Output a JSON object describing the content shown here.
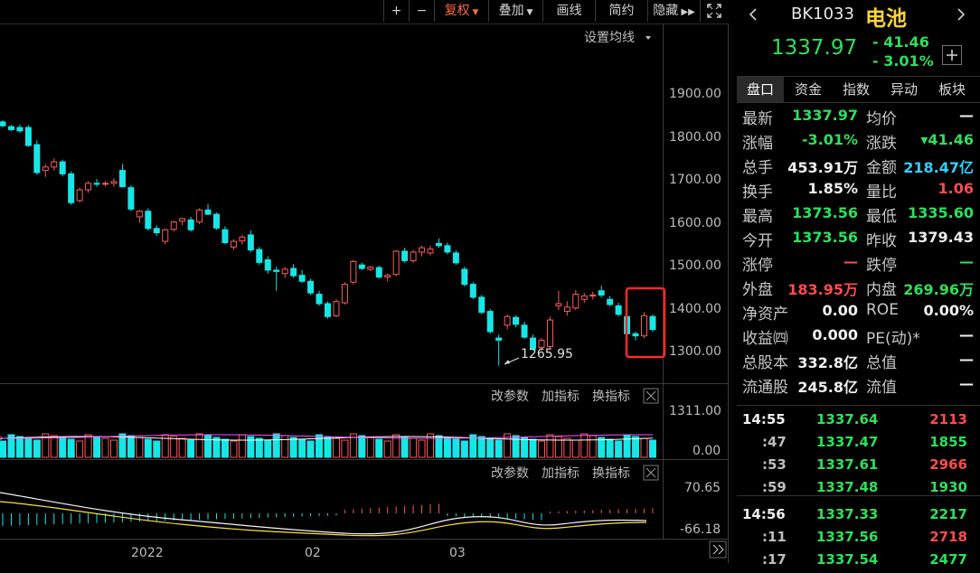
{
  "toolbar": {
    "plus": "+",
    "minus": "−",
    "fuquan": "复权",
    "diejia": "叠加",
    "huaxian": "画线",
    "jianyue": "简约",
    "yincang": "隐藏"
  },
  "chart": {
    "set_ma": "设置均线",
    "min_label": "1265.95",
    "y_ticks": [
      "1900.00",
      "1800.00",
      "1700.00",
      "1600.00",
      "1500.00",
      "1400.00",
      "1300.00"
    ],
    "vol_ticks": [
      "1311.00",
      "0.00"
    ],
    "macd_ticks": [
      "70.65",
      "-66.18"
    ],
    "indicator_buttons": [
      "改参数",
      "加指标",
      "换指标"
    ],
    "x_labels": [
      "2022",
      "02",
      "03"
    ]
  },
  "chart_data": {
    "type": "candlestick",
    "ylim": [
      1230,
      1960
    ],
    "x_labels": [
      "2022",
      "02",
      "03"
    ],
    "candles": [
      [
        1833,
        1837,
        1820,
        1824
      ],
      [
        1822,
        1826,
        1812,
        1815
      ],
      [
        1820,
        1827,
        1808,
        1812
      ],
      [
        1820,
        1825,
        1775,
        1778
      ],
      [
        1780,
        1790,
        1710,
        1715
      ],
      [
        1720,
        1735,
        1705,
        1728
      ],
      [
        1728,
        1748,
        1720,
        1740
      ],
      [
        1740,
        1745,
        1706,
        1712
      ],
      [
        1712,
        1718,
        1640,
        1645
      ],
      [
        1650,
        1680,
        1645,
        1675
      ],
      [
        1675,
        1695,
        1668,
        1690
      ],
      [
        1690,
        1700,
        1682,
        1688
      ],
      [
        1688,
        1695,
        1683,
        1690
      ],
      [
        1690,
        1702,
        1682,
        1694
      ],
      [
        1720,
        1735,
        1680,
        1682
      ],
      [
        1680,
        1685,
        1625,
        1630
      ],
      [
        1612,
        1628,
        1598,
        1625
      ],
      [
        1625,
        1632,
        1580,
        1585
      ],
      [
        1585,
        1592,
        1568,
        1575
      ],
      [
        1555,
        1585,
        1548,
        1582
      ],
      [
        1583,
        1603,
        1578,
        1600
      ],
      [
        1602,
        1610,
        1592,
        1608
      ],
      [
        1605,
        1612,
        1578,
        1582
      ],
      [
        1600,
        1632,
        1595,
        1628
      ],
      [
        1628,
        1642,
        1616,
        1618
      ],
      [
        1618,
        1622,
        1582,
        1586
      ],
      [
        1582,
        1590,
        1548,
        1552
      ],
      [
        1542,
        1560,
        1535,
        1555
      ],
      [
        1556,
        1570,
        1548,
        1565
      ],
      [
        1570,
        1580,
        1530,
        1535
      ],
      [
        1536,
        1542,
        1500,
        1506
      ],
      [
        1512,
        1520,
        1480,
        1488
      ],
      [
        1488,
        1496,
        1440,
        1485
      ],
      [
        1480,
        1496,
        1470,
        1490
      ],
      [
        1492,
        1502,
        1470,
        1475
      ],
      [
        1476,
        1488,
        1458,
        1462
      ],
      [
        1462,
        1468,
        1430,
        1435
      ],
      [
        1432,
        1440,
        1405,
        1410
      ],
      [
        1410,
        1415,
        1375,
        1380
      ],
      [
        1382,
        1420,
        1378,
        1415
      ],
      [
        1412,
        1460,
        1408,
        1455
      ],
      [
        1460,
        1512,
        1455,
        1508
      ],
      [
        1500,
        1505,
        1488,
        1492
      ],
      [
        1490,
        1498,
        1486,
        1495
      ],
      [
        1494,
        1498,
        1468,
        1472
      ],
      [
        1472,
        1480,
        1462,
        1476
      ],
      [
        1478,
        1535,
        1474,
        1532
      ],
      [
        1532,
        1540,
        1505,
        1510
      ],
      [
        1510,
        1535,
        1505,
        1530
      ],
      [
        1530,
        1545,
        1520,
        1540
      ],
      [
        1528,
        1545,
        1522,
        1537
      ],
      [
        1550,
        1562,
        1540,
        1545
      ],
      [
        1545,
        1552,
        1525,
        1530
      ],
      [
        1528,
        1534,
        1500,
        1505
      ],
      [
        1490,
        1496,
        1450,
        1455
      ],
      [
        1455,
        1460,
        1420,
        1425
      ],
      [
        1425,
        1430,
        1385,
        1390
      ],
      [
        1392,
        1398,
        1340,
        1345
      ],
      [
        1330,
        1338,
        1266,
        1325
      ],
      [
        1360,
        1385,
        1350,
        1380
      ],
      [
        1378,
        1382,
        1355,
        1362
      ],
      [
        1360,
        1368,
        1328,
        1332
      ],
      [
        1330,
        1338,
        1300,
        1305
      ],
      [
        1308,
        1330,
        1300,
        1325
      ],
      [
        1310,
        1380,
        1305,
        1372
      ],
      [
        1405,
        1440,
        1395,
        1410
      ],
      [
        1392,
        1415,
        1382,
        1402
      ],
      [
        1400,
        1442,
        1395,
        1432
      ],
      [
        1420,
        1435,
        1412,
        1428
      ],
      [
        1428,
        1438,
        1420,
        1430
      ],
      [
        1440,
        1452,
        1425,
        1430
      ],
      [
        1420,
        1428,
        1404,
        1408
      ],
      [
        1405,
        1412,
        1380,
        1385
      ],
      [
        1380,
        1385,
        1335,
        1340
      ],
      [
        1340,
        1345,
        1325,
        1335
      ],
      [
        1335,
        1390,
        1330,
        1382
      ],
      [
        1380,
        1385,
        1344,
        1350
      ]
    ],
    "volume_ylim": [
      0,
      1311
    ],
    "macd_ylim": [
      -66.18,
      70.65
    ]
  },
  "quote": {
    "code": "BK1033",
    "name": "电池",
    "price": "1337.97",
    "change": "- 41.46",
    "pct": "- 3.01%"
  },
  "tabs": [
    "盘口",
    "资金",
    "指数",
    "异动",
    "板块"
  ],
  "rows": [
    {
      "l1": "最新",
      "v1": "1337.97",
      "c1": "green",
      "l2": "均价",
      "v2": "—",
      "c2": "white"
    },
    {
      "l1": "涨幅",
      "v1": "-3.01%",
      "c1": "green",
      "l2": "涨跌",
      "v2": "▾41.46",
      "c2": "green"
    },
    {
      "l1": "总手",
      "v1": "453.91万",
      "c1": "white",
      "l2": "金额",
      "v2": "218.47亿",
      "c2": "cyan"
    },
    {
      "l1": "换手",
      "v1": "1.85%",
      "c1": "white",
      "l2": "量比",
      "v2": "1.06",
      "c2": "red"
    },
    {
      "l1": "最高",
      "v1": "1373.56",
      "c1": "green",
      "l2": "最低",
      "v2": "1335.60",
      "c2": "green"
    },
    {
      "l1": "今开",
      "v1": "1373.56",
      "c1": "green",
      "l2": "昨收",
      "v2": "1379.43",
      "c2": "white"
    },
    {
      "l1": "涨停",
      "v1": "—",
      "c1": "red",
      "l2": "跌停",
      "v2": "—",
      "c2": "green"
    },
    {
      "l1": "外盘",
      "v1": "183.95万",
      "c1": "red",
      "l2": "内盘",
      "v2": "269.96万",
      "c2": "green"
    },
    {
      "l1": "净资产",
      "v1": "0.00",
      "c1": "white",
      "l2": "ROE",
      "v2": "0.00%",
      "c2": "white"
    },
    {
      "l1": "收益㈣",
      "v1": "0.000",
      "c1": "white",
      "l2": "PE(动)*",
      "v2": "—",
      "c2": "white"
    },
    {
      "l1": "总股本",
      "v1": "332.8亿",
      "c1": "white",
      "l2": "总值",
      "v2": "—",
      "c2": "white"
    },
    {
      "l1": "流通股",
      "v1": "245.8亿",
      "c1": "white",
      "l2": "流值",
      "v2": "—",
      "c2": "white"
    }
  ],
  "ticks": [
    {
      "t": "14:55",
      "p": "1337.64",
      "v": "2113",
      "c": "red"
    },
    {
      "t": ":47",
      "p": "1337.47",
      "v": "1855",
      "c": "green"
    },
    {
      "t": ":53",
      "p": "1337.61",
      "v": "2966",
      "c": "red"
    },
    {
      "t": ":59",
      "p": "1337.48",
      "v": "1930",
      "c": "green"
    },
    {
      "t": "14:56",
      "p": "1337.33",
      "v": "2217",
      "c": "green"
    },
    {
      "t": ":11",
      "p": "1337.56",
      "v": "2718",
      "c": "red"
    },
    {
      "t": ":17",
      "p": "1337.54",
      "v": "2477",
      "c": "green"
    }
  ]
}
